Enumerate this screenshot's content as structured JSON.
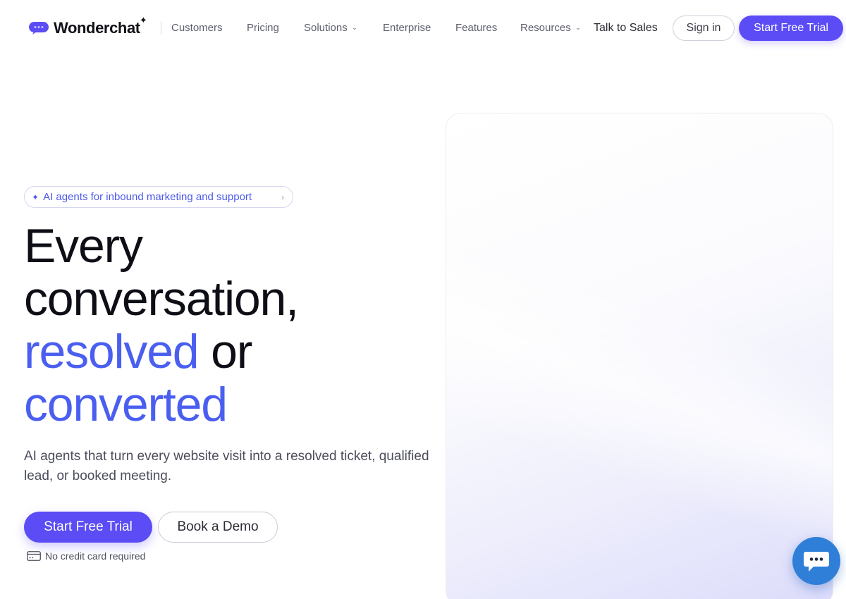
{
  "nav": {
    "brand": "Wonderchat",
    "links": [
      {
        "label": "Customers"
      },
      {
        "label": "Pricing"
      },
      {
        "label": "Solutions",
        "dropdown": true
      },
      {
        "label": "Enterprise"
      },
      {
        "label": "Features"
      },
      {
        "label": "Resources",
        "dropdown": true
      }
    ],
    "talk_to_sales": "Talk to Sales",
    "sign_in": "Sign in",
    "start_trial": "Start Free Trial"
  },
  "hero": {
    "badge": "AI agents for inbound marketing and support",
    "headline": {
      "line1": "Every",
      "line2": "conversation,",
      "line3_blue": "resolved",
      "line3_rest": " or",
      "line4_blue": "converted"
    },
    "subtext": "AI agents that turn every website visit into a resolved ticket, qualified lead, or booked meeting.",
    "cta_primary": "Start Free Trial",
    "cta_secondary": "Book a Demo",
    "note": "No credit card required"
  },
  "icons": {
    "logo": "chat-bubble-logo-icon",
    "sparkle": "sparkle-icon",
    "chevron": "chevron-down-icon",
    "card": "credit-card-icon",
    "chat": "chat-widget-icon"
  },
  "colors": {
    "accent": "#5b4cf5",
    "headline_blue": "#4a5ff0",
    "chat_fab": "#2f7fd8"
  }
}
